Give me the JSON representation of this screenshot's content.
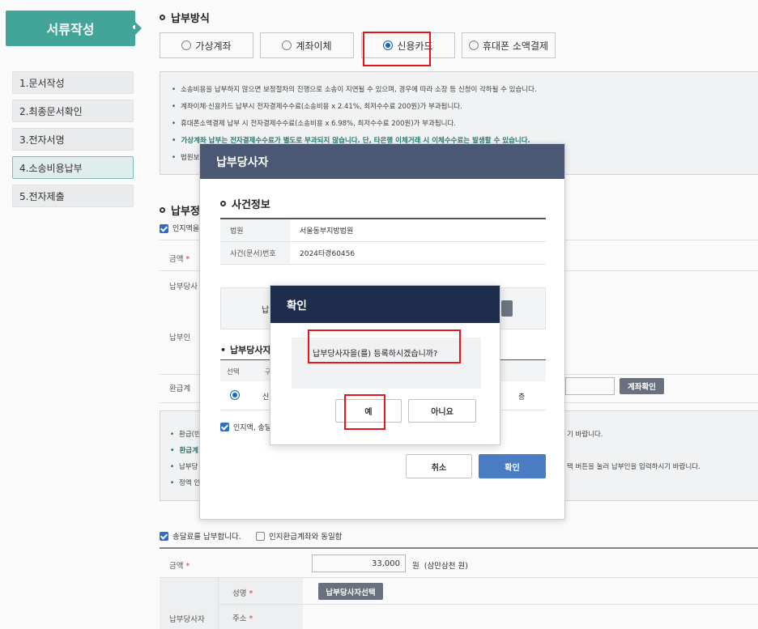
{
  "sidebar": {
    "badge": "서류작성",
    "steps": [
      {
        "label": "1.문서작성"
      },
      {
        "label": "2.최종문서확인"
      },
      {
        "label": "3.전자서명"
      },
      {
        "label": "4.소송비용납부"
      },
      {
        "label": "5.전자제출"
      }
    ]
  },
  "payment_method": {
    "title": "납부방식",
    "tabs": [
      {
        "label": "가상계좌",
        "selected": false
      },
      {
        "label": "계좌이체",
        "selected": false
      },
      {
        "label": "신용카드",
        "selected": true
      },
      {
        "label": "휴대폰 소액결제",
        "selected": false
      }
    ],
    "notices": [
      "소송비용을 납부하지 않으면 보정절차의 진행으로 소송이 지연될 수 있으며, 경우에 따라 소장 등 신청이 각하될 수 있습니다.",
      "계좌이체·신용카드 납부시 전자결제수수료(소송비용 x 2.41%, 최저수수료 200원)가 부과됩니다.",
      "휴대폰소액결제 납부 시 전자결제수수료(소송비용 x 6.98%, 최저수수료 200원)가 부과됩니다.",
      "가상계좌 납부는 전자결제수수료가 별도로 부과되지 않습니다. 단, 타은행 이체거래 시 이체수수료는 발생할 수 있습니다.",
      "법원보"
    ]
  },
  "payer_section": {
    "title": "납부정",
    "stamp_checkbox": "인지액을",
    "amount_label": "금액",
    "payer_party_label": "납부당사",
    "payer_label": "납부인",
    "refund_label": "환급계",
    "account_check_button": "계좌확인",
    "notices": [
      "환급(반",
      "환급계",
      "납부당",
      "정액 인",
      "기 바랍니다.",
      "택 버튼을 눌러 납부인을 입력하시기 바랍니다."
    ]
  },
  "delivery": {
    "checkbox_label": "송달료를 납부합니다.",
    "same_account_label": "인지환급계좌와 동일함",
    "amount_label": "금액",
    "amount_value": "33,000",
    "amount_unit": "원",
    "amount_korean": "(삼만삼천 원)",
    "payer_party_label": "납부당사자",
    "name_label": "성명",
    "select_payer_button": "납부당사자선택",
    "address_label": "주소"
  },
  "modal": {
    "title": "납부당사자",
    "section_title": "사건정보",
    "court_label": "법원",
    "court_value": "서울동부지방법원",
    "case_label": "사건(문서)번호",
    "case_value": "2024타경60456",
    "hidden_button_fragment": "납",
    "payer_list_title": "납부당사자",
    "col_select": "선택",
    "col_fragment": "구",
    "row_fragment": "신",
    "row_fragment_right": "층",
    "agree_checkbox": "인지액, 송달",
    "cancel_button": "취소",
    "confirm_button": "확인"
  },
  "confirm_dialog": {
    "title": "확인",
    "message": "납부당사자을(를) 등록하시겠습니까?",
    "yes_button": "예",
    "no_button": "아니요"
  }
}
